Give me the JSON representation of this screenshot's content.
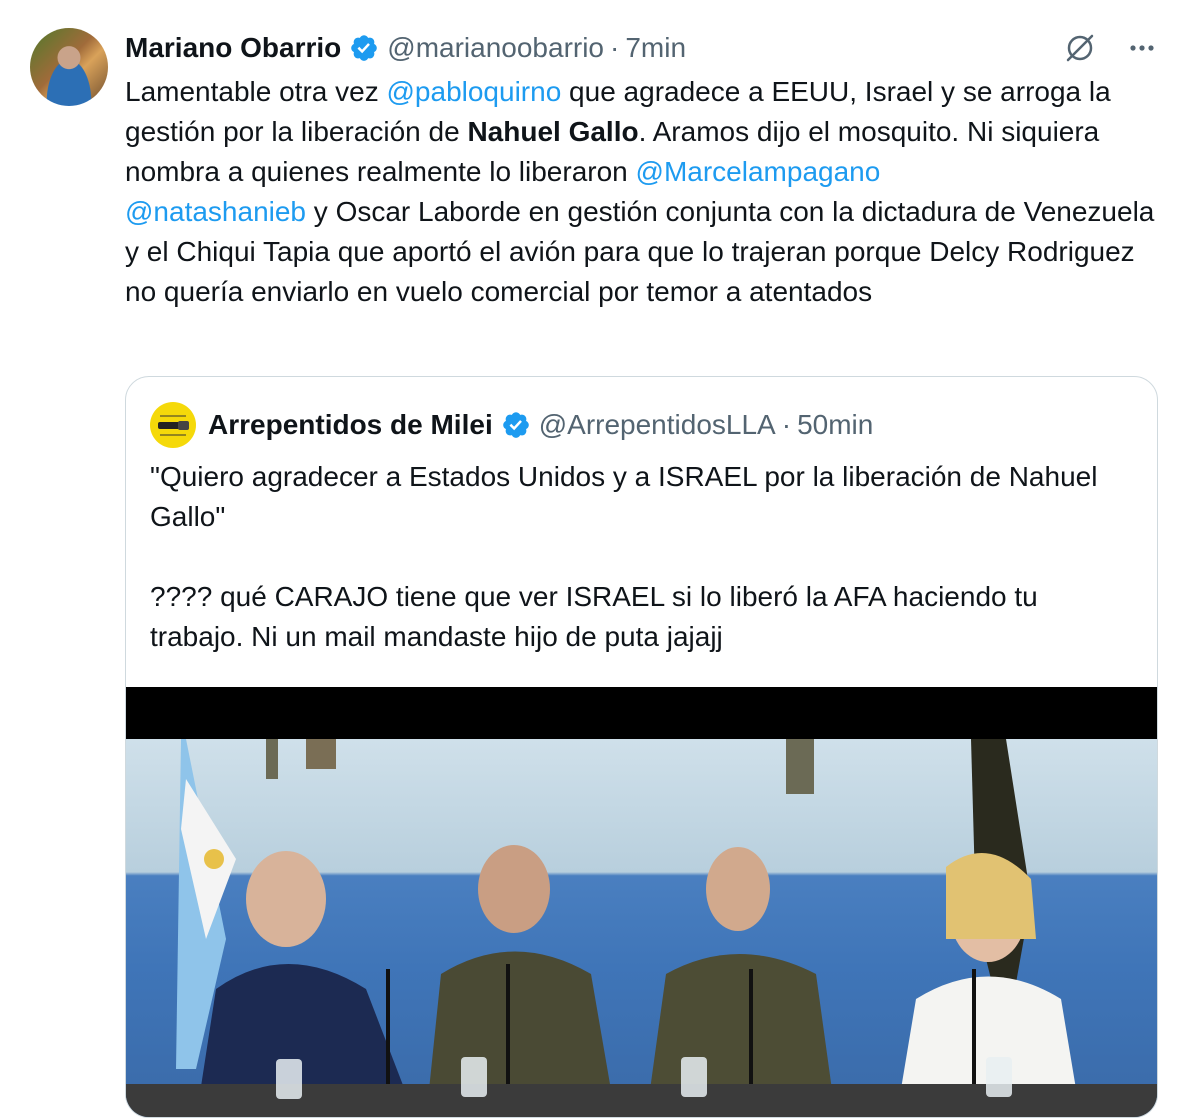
{
  "tweet": {
    "author_name": "Mariano Obarrio",
    "author_handle": "@marianoobarrio",
    "separator": "·",
    "time": "7min",
    "text_segments": [
      {
        "text": "Lamentable otra vez ",
        "type": "plain"
      },
      {
        "text": "@pabloquirno",
        "type": "mention"
      },
      {
        "text": " que agradece a EEUU, Israel y se arroga la gestión por la liberación de ",
        "type": "plain"
      },
      {
        "text": "Nahuel Gallo",
        "type": "bold"
      },
      {
        "text": ". Aramos dijo el mosquito. Ni siquiera nombra a quienes realmente lo liberaron ",
        "type": "plain"
      },
      {
        "text": "@Marcelampagano",
        "type": "mention"
      },
      {
        "text": " ",
        "type": "plain"
      },
      {
        "text": "@natashanieb",
        "type": "mention"
      },
      {
        "text": " y Oscar Laborde en gestión conjunta con la dictadura de Venezuela y el Chiqui Tapia que aportó el avión para que lo trajeran porque Delcy Rodriguez no quería enviarlo en vuelo comercial por temor a atentados",
        "type": "plain"
      }
    ]
  },
  "quote": {
    "author_name": "Arrepentidos de Milei",
    "author_handle": "@ArrepentidosLLA",
    "separator": "·",
    "time": "50min",
    "text": "\"Quiero agradecer a Estados Unidos y a ISRAEL por la liberación de Nahuel Gallo\"\n\n???? qué CARAJO tiene que ver ISRAEL si lo liberó la AFA haciendo tu trabajo. Ni un mail mandaste hijo de puta jajajj"
  },
  "colors": {
    "link": "#1d9bf0",
    "verified": "#1d9bf0",
    "secondary_text": "#536471",
    "border": "#cfd9de"
  },
  "icons": {
    "verified": "verified-badge-icon",
    "grok": "grok-icon",
    "more": "more-options-icon"
  }
}
